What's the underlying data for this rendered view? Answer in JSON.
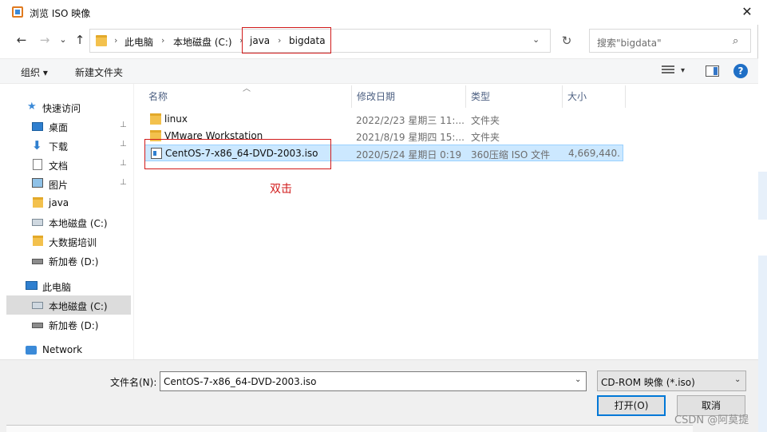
{
  "window": {
    "title": "浏览 ISO 映像",
    "close_glyph": "✕"
  },
  "nav": {
    "back_glyph": "←",
    "forward_glyph": "→",
    "recent_glyph": "⌄",
    "up_glyph": "↑",
    "breadcrumbs": [
      "此电脑",
      "本地磁盘 (C:)",
      "java",
      "bigdata"
    ],
    "separator": "›",
    "refresh_glyph": "↻",
    "search_placeholder": "搜索\"bigdata\"",
    "search_glyph": "⌕"
  },
  "toolbar": {
    "organize_label": "组织 ▾",
    "new_folder_label": "新建文件夹",
    "view_drop": "▾",
    "help_label": "?"
  },
  "sidebar": {
    "items": [
      {
        "label": "快速访问",
        "icon": "star-icon",
        "pinned": false
      },
      {
        "label": "桌面",
        "icon": "desktop-icon",
        "pinned": true
      },
      {
        "label": "下载",
        "icon": "download-icon",
        "pinned": true
      },
      {
        "label": "文档",
        "icon": "document-icon",
        "pinned": true
      },
      {
        "label": "图片",
        "icon": "picture-icon",
        "pinned": true
      },
      {
        "label": "java",
        "icon": "folder-icon",
        "pinned": false
      },
      {
        "label": "本地磁盘 (C:)",
        "icon": "drive-icon",
        "pinned": false
      },
      {
        "label": "大数据培训",
        "icon": "folder-icon",
        "pinned": false
      },
      {
        "label": "新加卷 (D:)",
        "icon": "drive-icon",
        "pinned": false
      },
      {
        "label": "此电脑",
        "icon": "computer-icon",
        "pinned": false
      },
      {
        "label": "本地磁盘 (C:)",
        "icon": "drive-icon",
        "pinned": false,
        "selected": true
      },
      {
        "label": "新加卷 (D:)",
        "icon": "drive-icon",
        "pinned": false
      },
      {
        "label": "Network",
        "icon": "network-icon",
        "pinned": false
      }
    ],
    "pin_glyph": "📌"
  },
  "file_list": {
    "columns": [
      "名称",
      "修改日期",
      "类型",
      "大小"
    ],
    "sort_caret": "︿",
    "rows": [
      {
        "name": "linux",
        "date": "2022/2/23 星期三 11:...",
        "type": "文件夹",
        "size": "",
        "icon": "folder-icon"
      },
      {
        "name": "VMware Workstation",
        "date": "2021/8/19 星期四 15:...",
        "type": "文件夹",
        "size": "",
        "icon": "folder-icon"
      },
      {
        "name": "CentOS-7-x86_64-DVD-2003.iso",
        "date": "2020/5/24 星期日 0:19",
        "type": "360压缩 ISO 文件",
        "size": "4,669,440...",
        "icon": "iso-file-icon",
        "selected": true
      }
    ]
  },
  "annotation": {
    "text": "双击",
    "color": "#d11a1a"
  },
  "bottom": {
    "filename_label": "文件名(N):",
    "filename_value": "CentOS-7-x86_64-DVD-2003.iso",
    "filetype_value": "CD-ROM 映像 (*.iso)",
    "dropdown_glyph": "⌄",
    "open_label": "打开(O)",
    "cancel_label": "取消"
  },
  "watermark": "CSDN @阿莫提"
}
